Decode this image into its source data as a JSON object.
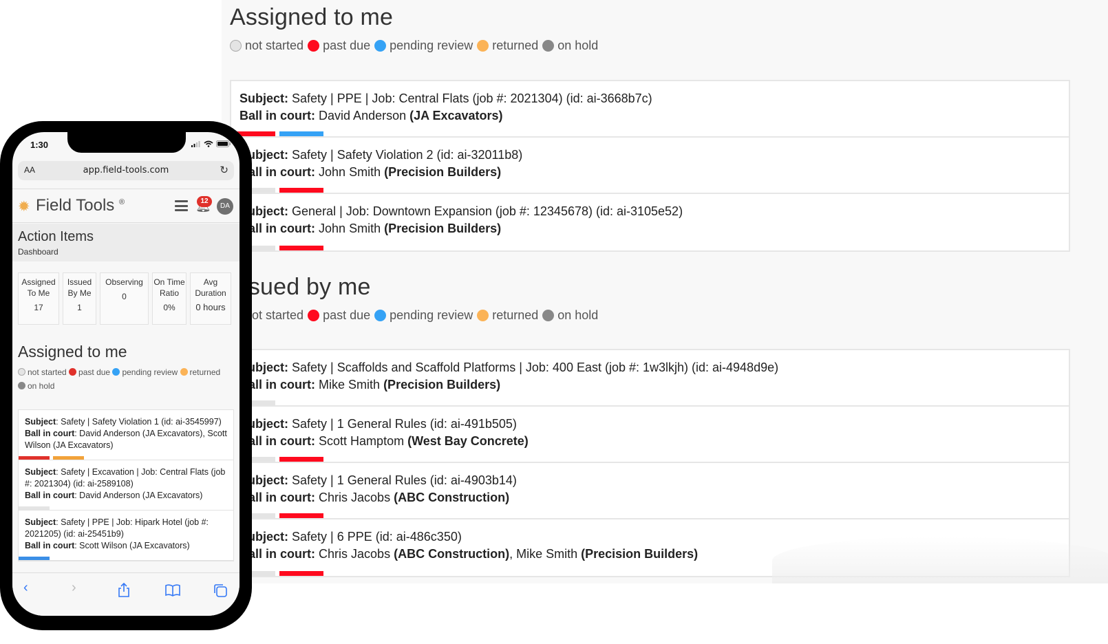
{
  "colors": {
    "not_started": "#e4e4e4",
    "past_due": "#ff0a1e",
    "pending_review": "#35a2f5",
    "returned": "#fbb357",
    "on_hold": "#888888",
    "mobile_past_due": "#e0312b",
    "mobile_returned": "#f2a23a",
    "mobile_pending_review": "#3a8ee6"
  },
  "legend": [
    {
      "key": "not_started",
      "label": "not started"
    },
    {
      "key": "past_due",
      "label": "past due"
    },
    {
      "key": "pending_review",
      "label": "pending review"
    },
    {
      "key": "returned",
      "label": "returned"
    },
    {
      "key": "on_hold",
      "label": "on hold"
    }
  ],
  "desktop": {
    "assigned": {
      "title": "Assigned to me",
      "items": [
        {
          "subject_label": "Subject:",
          "subject": "Safety | PPE | Job: Central Flats (job #: 2021304) (id: ai-3668b7c)",
          "bic_label": "Ball in court:",
          "bic_name": "David Anderson",
          "bic_company": "(JA Excavators)",
          "bars": [
            "past_due",
            "pending_review"
          ]
        },
        {
          "subject_label": "Subject:",
          "subject": "Safety | Safety Violation 2 (id: ai-32011b8)",
          "bic_label": "Ball in court:",
          "bic_name": "John Smith",
          "bic_company": "(Precision Builders)",
          "bars": [
            "not_started",
            "past_due"
          ]
        },
        {
          "subject_label": "Subject:",
          "subject": "General | Job: Downtown Expansion (job #: 12345678) (id: ai-3105e52)",
          "bic_label": "Ball in court:",
          "bic_name": "John Smith",
          "bic_company": "(Precision Builders)",
          "bars": [
            "not_started",
            "past_due"
          ]
        }
      ]
    },
    "issued": {
      "title": "Issued by me",
      "items": [
        {
          "subject_label": "Subject:",
          "subject": "Safety | Scaffolds and Scaffold Platforms | Job: 400 East (job #: 1w3lkjh) (id: ai-4948d9e)",
          "bic_label": "Ball in court:",
          "bic_name": "Mike Smith",
          "bic_company": "(Precision Builders)",
          "bars": [
            "not_started"
          ]
        },
        {
          "subject_label": "Subject:",
          "subject": "Safety | 1 General Rules (id: ai-491b505)",
          "bic_label": "Ball in court:",
          "bic_name": "Scott Hamptom",
          "bic_company": "(West Bay Concrete)",
          "bars": [
            "not_started",
            "past_due"
          ]
        },
        {
          "subject_label": "Subject:",
          "subject": "Safety | 1 General Rules (id: ai-4903b14)",
          "bic_label": "Ball in court:",
          "bic_name": "Chris Jacobs",
          "bic_company": "(ABC Construction)",
          "bars": [
            "not_started",
            "past_due"
          ]
        },
        {
          "subject_label": "Subject:",
          "subject": "Safety | 6 PPE (id: ai-486c350)",
          "bic_label": "Ball in court:",
          "bic_name": "Chris Jacobs",
          "bic_company": "(ABC Construction)",
          "bic_extra_name": ", Mike Smith",
          "bic_extra_company": "(Precision Builders)",
          "bars": [
            "not_started",
            "past_due"
          ]
        }
      ]
    }
  },
  "phone": {
    "time": "1:30",
    "url_aa": "AA",
    "url": "app.field-tools.com",
    "app_name": "Field Tools",
    "registered": "®",
    "notification_count": "12",
    "avatar_initials": "DA",
    "page_title": "Action Items",
    "page_subtitle": "Dashboard",
    "stats": [
      {
        "label": "Assigned To Me",
        "value": "17"
      },
      {
        "label": "Issued By Me",
        "value": "1"
      },
      {
        "label": "Observing",
        "value": "0"
      },
      {
        "label": "On Time Ratio",
        "value": "0%"
      },
      {
        "label": "Avg Duration",
        "value": "0 hours"
      }
    ],
    "section_title": "Assigned to me",
    "items": [
      {
        "subject_label": "Subject",
        "subject": ": Safety | Safety Violation 1 (id: ai-3545997)",
        "bic_label": "Ball in court",
        "bic": ": David Anderson (JA Excavators), Scott Wilson (JA Excavators)",
        "bars": [
          "mobile_past_due",
          "mobile_returned"
        ]
      },
      {
        "subject_label": "Subject",
        "subject": ": Safety | Excavation | Job: Central Flats (job #: 2021304) (id: ai-2589108)",
        "bic_label": "Ball in court",
        "bic": ": David Anderson (JA Excavators)",
        "bars": [
          "not_started"
        ]
      },
      {
        "subject_label": "Subject",
        "subject": ": Safety | PPE | Job: Hipark Hotel (job #: 2021205) (id: ai-25451b9)",
        "bic_label": "Ball in court",
        "bic": ": Scott Wilson (JA Excavators)",
        "bars": [
          "mobile_pending_review"
        ]
      }
    ],
    "toolbar_icons": [
      "back-icon",
      "forward-icon",
      "share-icon",
      "bookmarks-icon",
      "tabs-icon"
    ]
  }
}
